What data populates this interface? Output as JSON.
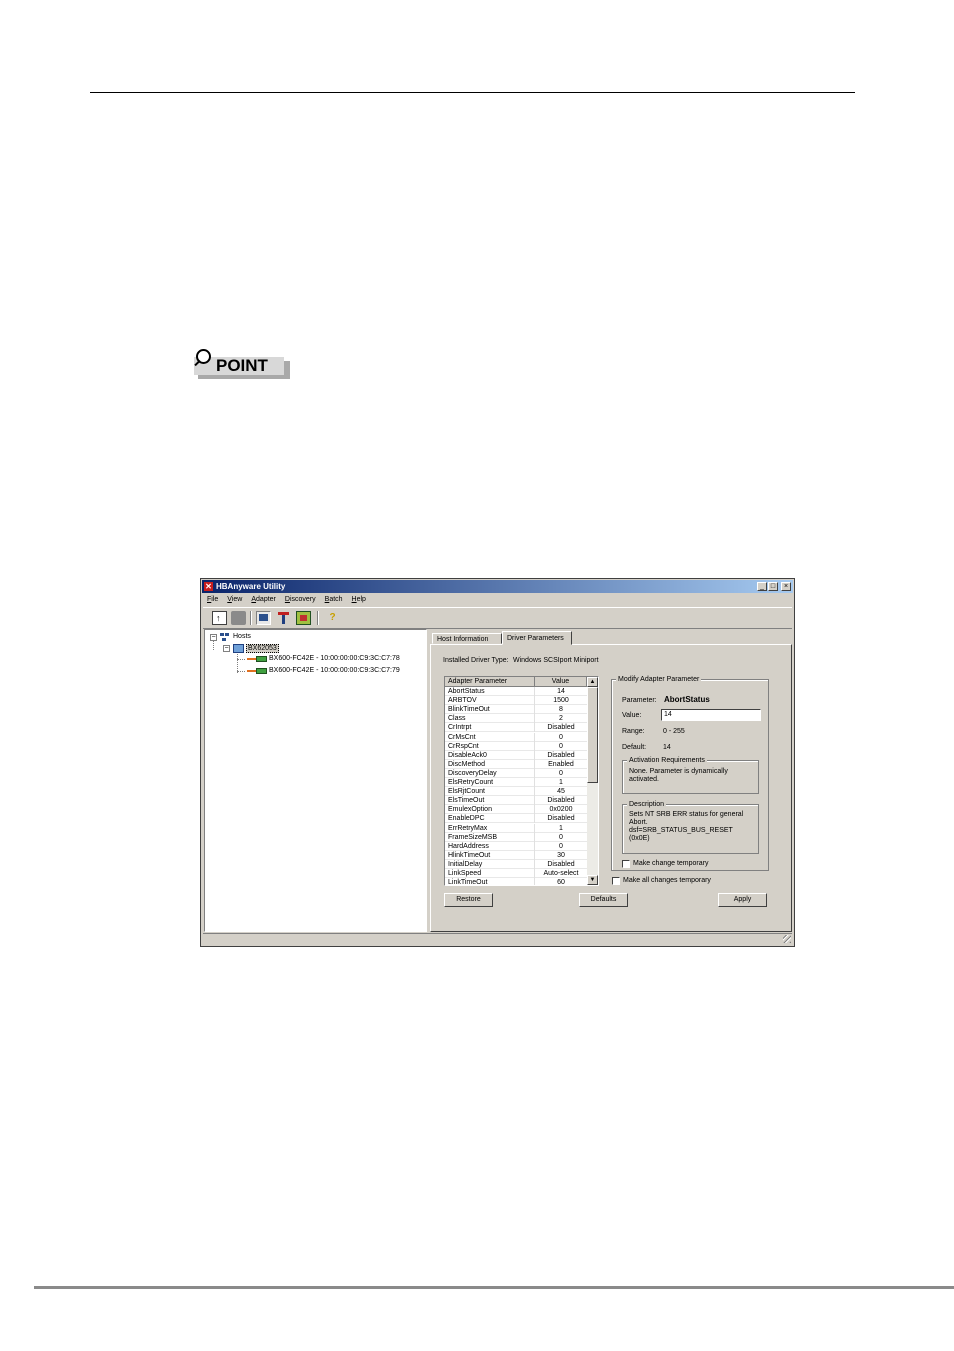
{
  "badge": {
    "label": "POINT"
  },
  "window": {
    "title": "HBAnyware Utility",
    "menu": [
      "File",
      "View",
      "Adapter",
      "Discovery",
      "Batch",
      "Help"
    ],
    "tree": {
      "root": "Hosts",
      "host": "BX62053",
      "adapters": [
        "BX600-FC42E - 10:00:00:00:C9:3C:C7:78",
        "BX600-FC42E - 10:00:00:00:C9:3C:C7:79"
      ]
    },
    "tabs": [
      "Host Information",
      "Driver Parameters"
    ],
    "active_tab": "Driver Parameters",
    "driver_type_label": "Installed Driver Type:",
    "driver_type_value": "Windows SCSIport Miniport",
    "table": {
      "col_param": "Adapter Parameter",
      "col_value": "Value",
      "rows": [
        {
          "name": "AbortStatus",
          "value": "14"
        },
        {
          "name": "ARBTOV",
          "value": "1500"
        },
        {
          "name": "BlinkTimeOut",
          "value": "8"
        },
        {
          "name": "Class",
          "value": "2"
        },
        {
          "name": "CrIntrpt",
          "value": "Disabled"
        },
        {
          "name": "CrMsCnt",
          "value": "0"
        },
        {
          "name": "CrRspCnt",
          "value": "0"
        },
        {
          "name": "DisableAck0",
          "value": "Disabled"
        },
        {
          "name": "DiscMethod",
          "value": "Enabled"
        },
        {
          "name": "DiscoveryDelay",
          "value": "0"
        },
        {
          "name": "ElsRetryCount",
          "value": "1"
        },
        {
          "name": "ElsRjtCount",
          "value": "45"
        },
        {
          "name": "ElsTimeOut",
          "value": "Disabled"
        },
        {
          "name": "EmulexOption",
          "value": "0x0200"
        },
        {
          "name": "EnableDPC",
          "value": "Disabled"
        },
        {
          "name": "ErrRetryMax",
          "value": "1"
        },
        {
          "name": "FrameSizeMSB",
          "value": "0"
        },
        {
          "name": "HardAddress",
          "value": "0"
        },
        {
          "name": "HlinkTimeOut",
          "value": "30"
        },
        {
          "name": "InitialDelay",
          "value": "Disabled"
        },
        {
          "name": "LinkSpeed",
          "value": "Auto-select"
        },
        {
          "name": "LinkTimeOut",
          "value": "60"
        }
      ]
    },
    "modify": {
      "legend": "Modify Adapter Parameter",
      "param_label": "Parameter:",
      "param_value": "AbortStatus",
      "value_label": "Value:",
      "value_input": "14",
      "range_label": "Range:",
      "range_value": "0 - 255",
      "default_label": "Default:",
      "default_value": "14",
      "activation_legend": "Activation Requirements",
      "activation_text": "None. Parameter is dynamically activated.",
      "description_legend": "Description",
      "description_text": "Sets NT SRB ERR status for general Abort. dsf=SRB_STATUS_BUS_RESET (0x0E)",
      "temp_label": "Make change temporary"
    },
    "all_temp_label": "Make all changes temporary",
    "buttons": {
      "restore": "Restore",
      "defaults": "Defaults",
      "apply": "Apply"
    }
  }
}
